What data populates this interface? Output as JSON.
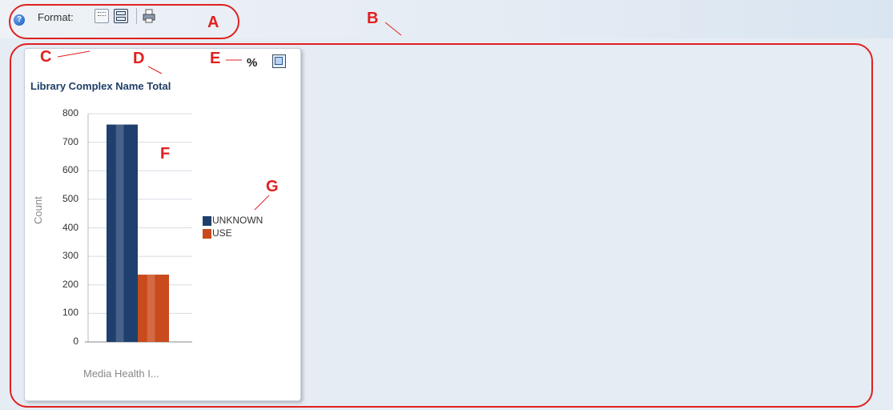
{
  "toolbar": {
    "format_label": "Format:",
    "help_icon": "help-icon",
    "grid_icon": "grid-format-icon",
    "stacked_icon": "stacked-format-icon",
    "print_icon": "print-icon"
  },
  "annotations": {
    "A": "A",
    "B": "B",
    "C": "C",
    "D": "D",
    "E": "E",
    "F": "F",
    "G": "G",
    "color": "#e02020"
  },
  "panel": {
    "title": "Library Complex Name Total",
    "percent_icon_text": "%",
    "expand_icon": "expand-icon"
  },
  "chart_data": {
    "type": "bar",
    "categories": [
      "Media Health I..."
    ],
    "series": [
      {
        "name": "UNKNOWN",
        "values": [
          762
        ],
        "color": "#1f3f6e"
      },
      {
        "name": "USE",
        "values": [
          236
        ],
        "color": "#c94a1c"
      }
    ],
    "title": "Library Complex Name Total",
    "xlabel": "Media Health I...",
    "ylabel": "Count",
    "ylim": [
      0,
      800
    ],
    "yticks": [
      "800",
      "700",
      "600",
      "500",
      "400",
      "300",
      "200",
      "100",
      "0"
    ],
    "legend": "right"
  }
}
